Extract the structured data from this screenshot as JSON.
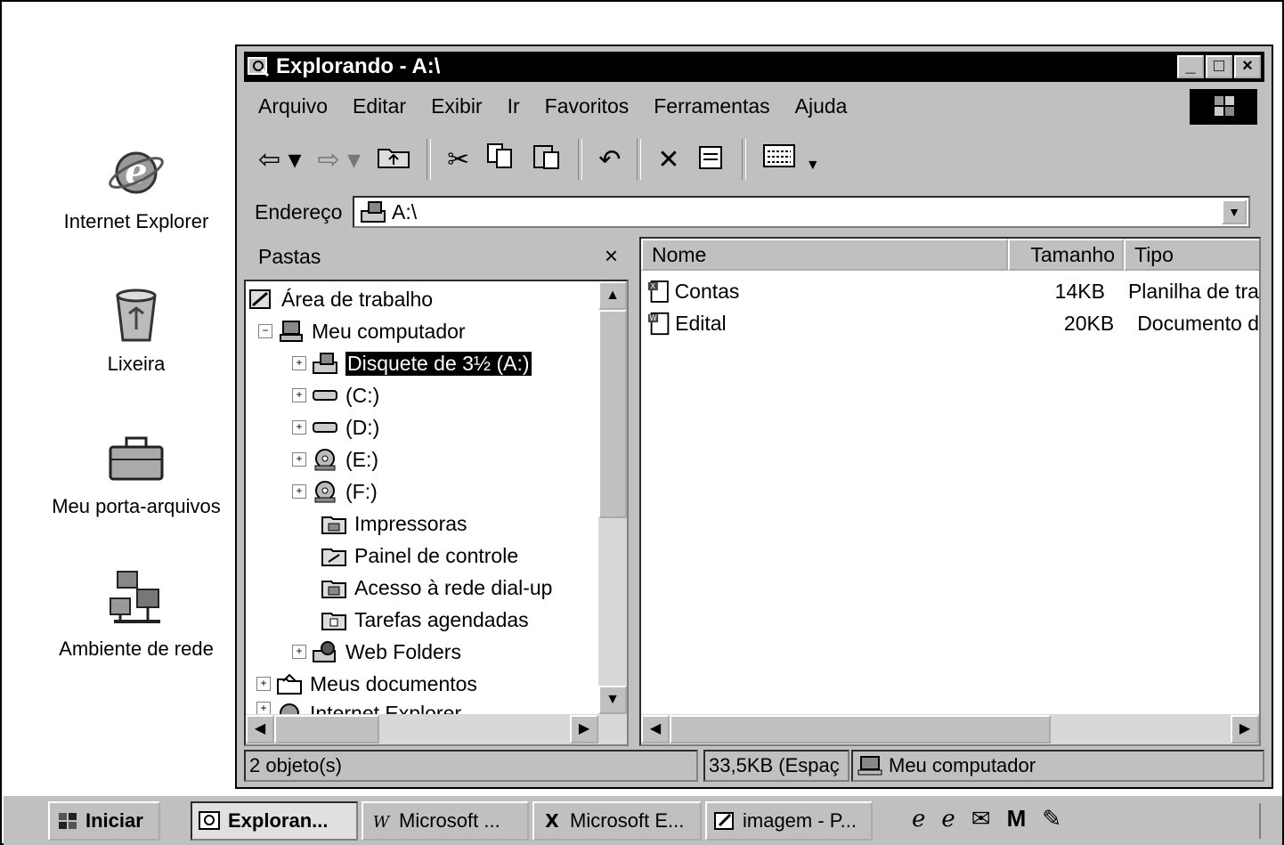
{
  "desktop": {
    "icons": [
      {
        "label": "Internet Explorer",
        "icon": "ie-icon"
      },
      {
        "label": "Lixeira",
        "icon": "recycle-bin-icon"
      },
      {
        "label": "Meu porta-arquivos",
        "icon": "briefcase-icon"
      },
      {
        "label": "Ambiente de rede",
        "icon": "network-icon"
      }
    ]
  },
  "window": {
    "title": "Explorando - A:\\",
    "menu": [
      "Arquivo",
      "Editar",
      "Exibir",
      "Ir",
      "Favoritos",
      "Ferramentas",
      "Ajuda"
    ],
    "address_label": "Endereço",
    "address_value": "A:\\",
    "folders_title": "Pastas",
    "folders_close": "×",
    "tree": [
      {
        "label": "Área de trabalho",
        "icon": "desktop-icon"
      },
      {
        "label": "Meu computador",
        "icon": "computer-icon",
        "expander": "−"
      },
      {
        "label": "Disquete de 3½ (A:)",
        "icon": "floppy-icon",
        "expander": "+",
        "selected": true
      },
      {
        "label": "(C:)",
        "icon": "drive-icon",
        "expander": "+"
      },
      {
        "label": "(D:)",
        "icon": "drive-icon",
        "expander": "+"
      },
      {
        "label": "(E:)",
        "icon": "cdrom-icon",
        "expander": "+"
      },
      {
        "label": "(F:)",
        "icon": "cdrom-icon",
        "expander": "+"
      },
      {
        "label": "Impressoras",
        "icon": "printers-icon"
      },
      {
        "label": "Painel de controle",
        "icon": "control-panel-icon"
      },
      {
        "label": "Acesso à rede dial-up",
        "icon": "dialup-icon"
      },
      {
        "label": "Tarefas agendadas",
        "icon": "scheduled-tasks-icon"
      },
      {
        "label": "Web Folders",
        "icon": "web-folders-icon",
        "expander": "+"
      },
      {
        "label": "Meus documentos",
        "icon": "my-documents-icon",
        "expander": "+"
      },
      {
        "label": "Internet Explorer",
        "icon": "ie-icon",
        "expander": "+"
      }
    ],
    "columns": [
      "Nome",
      "Tamanho",
      "Tipo"
    ],
    "files": [
      {
        "name": "Contas",
        "size": "14KB",
        "type": "Planilha de tra",
        "icon": "excel-file-icon"
      },
      {
        "name": "Edital",
        "size": "20KB",
        "type": "Documento d",
        "icon": "word-file-icon"
      }
    ],
    "status": {
      "objects": "2 objeto(s)",
      "free_space": "33,5KB (Espaç",
      "location": "Meu computador"
    }
  },
  "taskbar": {
    "start_label": "Iniciar",
    "buttons": [
      {
        "label": "Exploran...",
        "icon": "explorer-icon",
        "active": true
      },
      {
        "label": "Microsoft ...",
        "icon": "word-icon",
        "active": false
      },
      {
        "label": "Microsoft E...",
        "icon": "excel-icon",
        "active": false
      },
      {
        "label": "imagem - P...",
        "icon": "paint-icon",
        "active": false
      }
    ]
  }
}
